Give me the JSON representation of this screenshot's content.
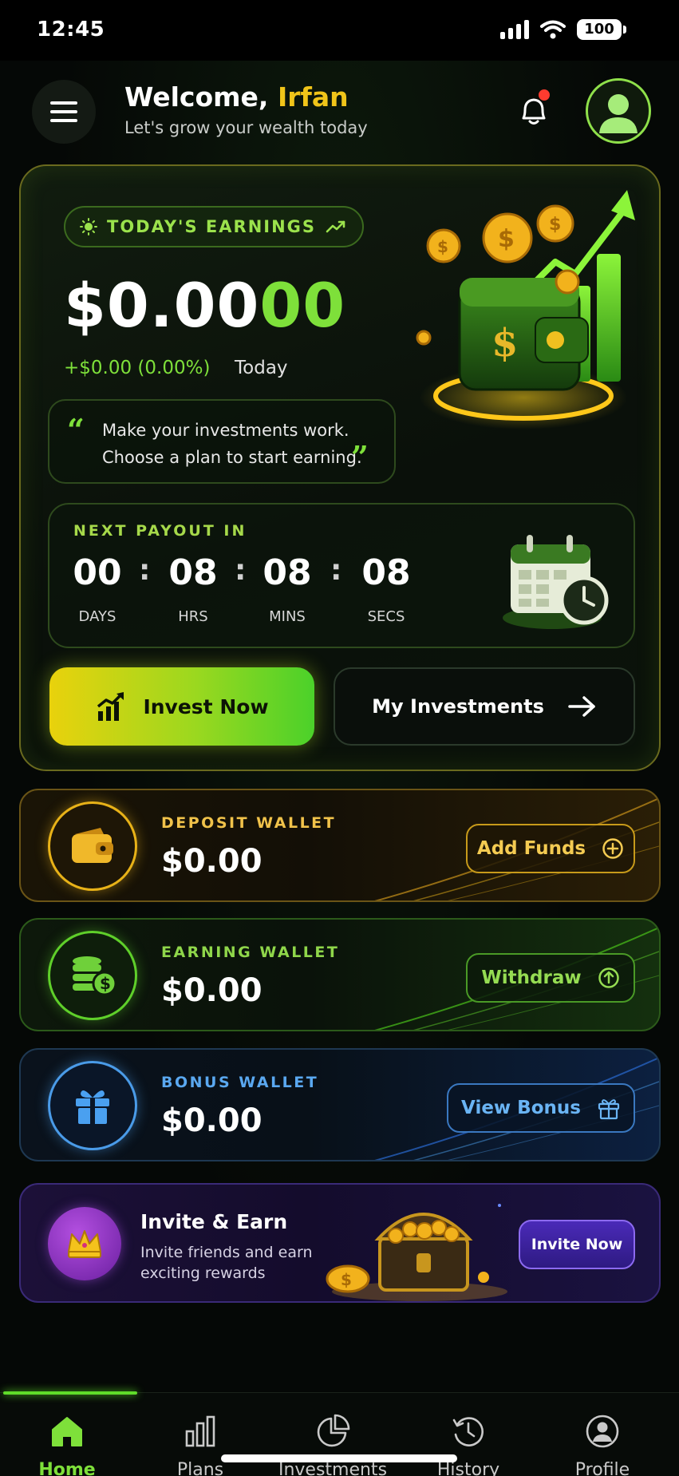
{
  "status_bar": {
    "time": "12:45",
    "battery": "100"
  },
  "header": {
    "welcome_prefix": "Welcome, ",
    "user_name": "Irfan",
    "subtitle": "Let's grow your wealth today"
  },
  "hero": {
    "earnings_label": "TODAY'S EARNINGS",
    "amount_main": "$0.00",
    "amount_fraction": "00",
    "change": "+$0.00 (0.00%)",
    "period": "Today",
    "quote": "Make your investments work. Choose a plan to start earning.",
    "payout": {
      "label": "NEXT PAYOUT IN",
      "days": "00",
      "days_label": "DAYS",
      "hours": "08",
      "hours_label": "HRS",
      "mins": "08",
      "mins_label": "MINS",
      "secs": "08",
      "secs_label": "SECS"
    },
    "invest_button": "Invest Now",
    "my_investments_button": "My Investments"
  },
  "wallets": {
    "deposit": {
      "label": "DEPOSIT WALLET",
      "amount": "$0.00",
      "action": "Add Funds"
    },
    "earning": {
      "label": "EARNING WALLET",
      "amount": "$0.00",
      "action": "Withdraw"
    },
    "bonus": {
      "label": "BONUS WALLET",
      "amount": "$0.00",
      "action": "View Bonus"
    }
  },
  "invite": {
    "title": "Invite & Earn",
    "subtitle": "Invite friends and earn exciting rewards",
    "button": "Invite Now"
  },
  "nav": {
    "items": [
      {
        "label": "Home",
        "icon": "home-icon",
        "active": true
      },
      {
        "label": "Plans",
        "icon": "bar-chart-icon",
        "active": false
      },
      {
        "label": "Investments",
        "icon": "pie-chart-icon",
        "active": false
      },
      {
        "label": "History",
        "icon": "history-icon",
        "active": false
      },
      {
        "label": "Profile",
        "icon": "profile-icon",
        "active": false
      }
    ]
  },
  "colors": {
    "accent_green": "#7ee03a",
    "accent_gold": "#f0c419",
    "deposit": "#e8b218",
    "earning": "#5fcf2a",
    "bonus": "#4a9be8",
    "invite": "#6a1fa0"
  }
}
